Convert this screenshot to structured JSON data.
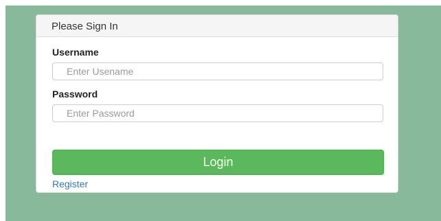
{
  "panel": {
    "title": "Please Sign In"
  },
  "form": {
    "username_label": "Username",
    "username_placeholder": "Enter Usename",
    "username_value": "",
    "password_label": "Password",
    "password_placeholder": "Enter Password",
    "password_value": "",
    "login_label": "Login",
    "register_label": "Register"
  },
  "colors": {
    "background": "#87b99a",
    "login_button": "#5cb85c",
    "link": "#337ab7"
  }
}
